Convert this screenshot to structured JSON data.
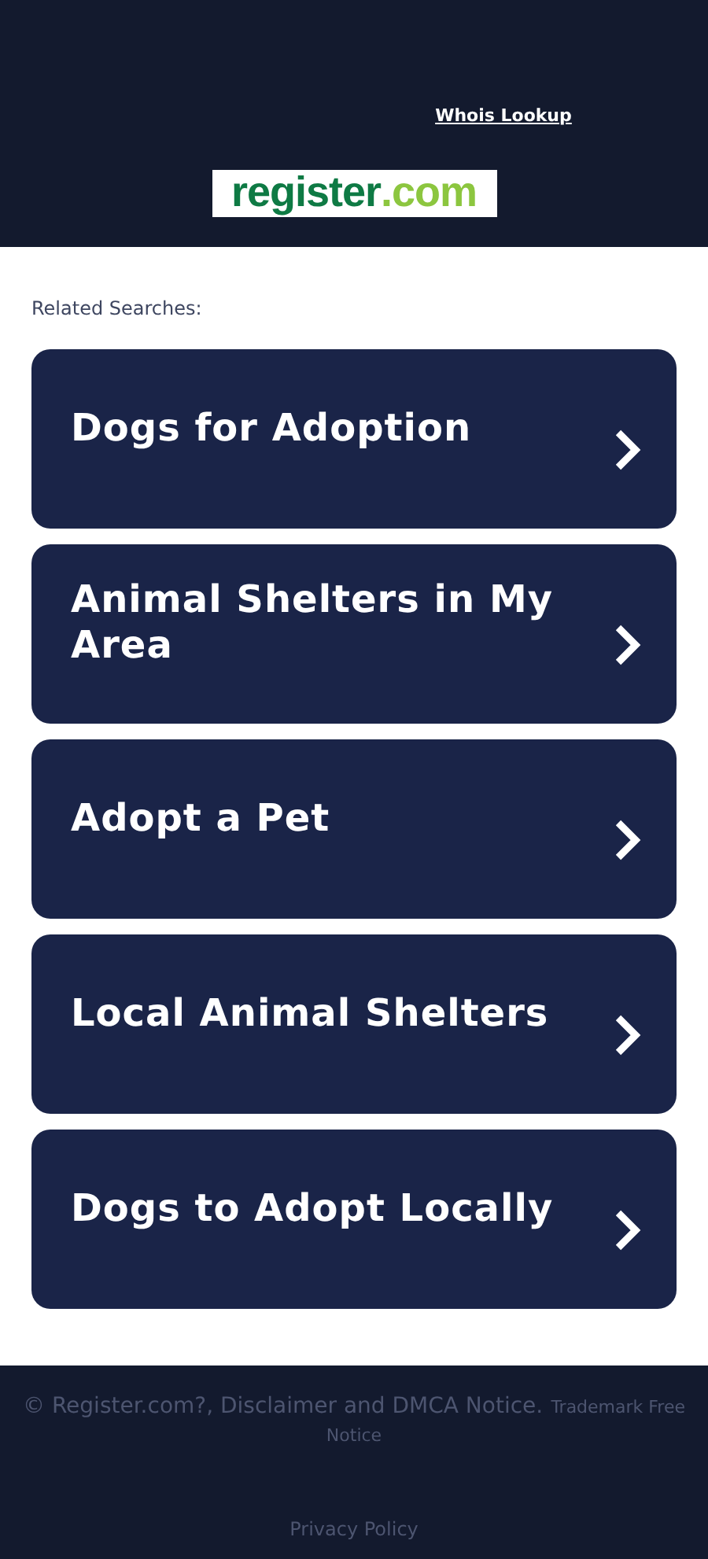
{
  "header": {
    "link": "Whois Lookup",
    "logo": {
      "name": "register",
      "suffix": ".com"
    }
  },
  "related": {
    "heading": "Related Searches:",
    "items": [
      {
        "label": "Dogs for Adoption"
      },
      {
        "label": "Animal Shelters in My Area"
      },
      {
        "label": "Adopt a Pet"
      },
      {
        "label": "Local Animal Shelters"
      },
      {
        "label": "Dogs to Adopt Locally"
      }
    ]
  },
  "footer": {
    "copyright": "© Register.com?, Disclaimer and DMCA Notice.",
    "trademark": "Trademark Free Notice",
    "privacy": "Privacy Policy"
  }
}
